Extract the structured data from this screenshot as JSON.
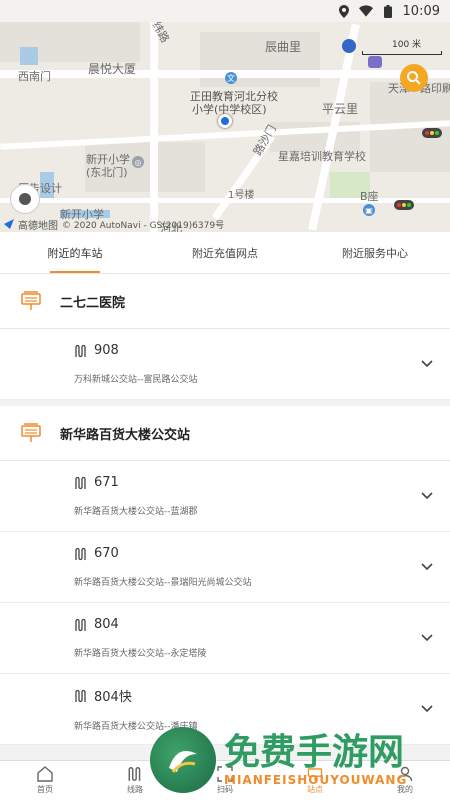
{
  "status_bar": {
    "time": "10:09"
  },
  "map": {
    "labels": {
      "weiroad": "纬路",
      "chenqu": "辰曲里",
      "xinanmen": "西南门",
      "chenyue": "晨悦大厦",
      "school": "正田教育河北分校",
      "school2": "小学(中学校区)",
      "pingyun": "平云里",
      "tianjin": "天津",
      "tianjin2": "路印刷",
      "xinkai": "新开小学",
      "xinkai2": "(东北门)",
      "xingjia": "星嘉培训教育学校",
      "road": "路沙门",
      "building1": "1号楼",
      "bzuo": "B座",
      "ad": "原告设计",
      "xinkai3": "新开小学",
      "hebei": "河北"
    },
    "scale": "100 米",
    "copyright_brand": "高德地图",
    "copyright": "© 2020 AutoNavi - GS(2019)6379号"
  },
  "tabs": [
    {
      "label": "附近的车站"
    },
    {
      "label": "附近充值网点"
    },
    {
      "label": "附近服务中心"
    }
  ],
  "stations": [
    {
      "name": "二七二医院",
      "routes": [
        {
          "number": "908",
          "direction": "万科新城公交站--富民路公交站"
        }
      ]
    },
    {
      "name": "新华路百货大楼公交站",
      "routes": [
        {
          "number": "671",
          "direction": "新华路百货大楼公交站--蓝湖郡"
        },
        {
          "number": "670",
          "direction": "新华路百货大楼公交站--景瑞阳光尚城公交站"
        },
        {
          "number": "804",
          "direction": "新华路百货大楼公交站--永定塔陵"
        },
        {
          "number": "804快",
          "direction": "新华路百货大楼公交站--潘庄镇"
        }
      ]
    }
  ],
  "bottom_nav": [
    {
      "label": "首页"
    },
    {
      "label": "线路"
    },
    {
      "label": "扫码"
    },
    {
      "label": "站点"
    },
    {
      "label": "我的"
    }
  ],
  "watermark": {
    "big": "免费手游网",
    "small": "MIANFEISHOUYOUWANG"
  },
  "colors": {
    "accent": "#f08c2a",
    "map_bg": "#eeebe4",
    "pin": "#1e6fd9"
  }
}
